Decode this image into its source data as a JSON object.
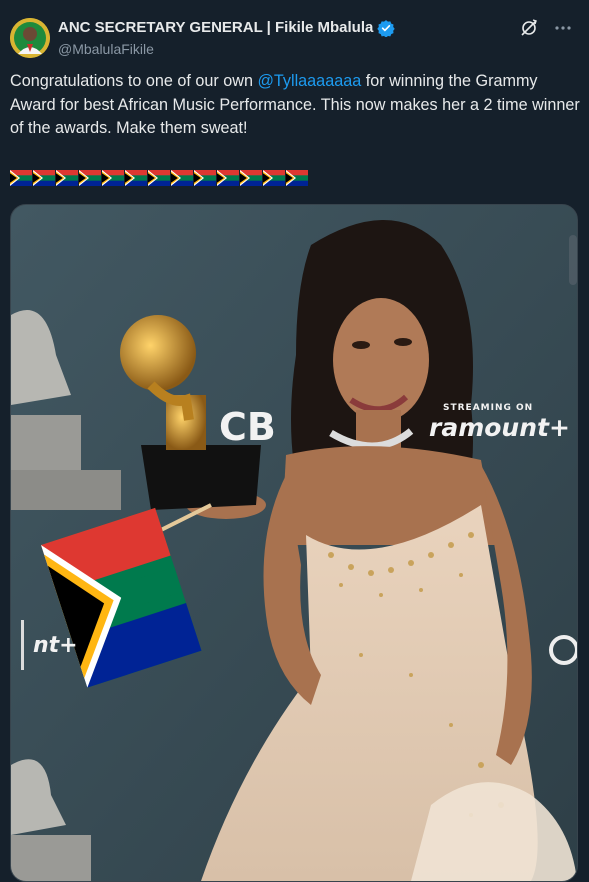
{
  "author": {
    "display_name": "ANC SECRETARY GENERAL | Fikile Mbalula",
    "handle": "@MbalulaFikile",
    "verified": true,
    "avatar_icon": "avatar-photo"
  },
  "header_actions": {
    "grok_icon": "grok-icon",
    "more_icon": "more-dots-icon"
  },
  "tweet": {
    "text_before_mention": "Congratulations to one of our own ",
    "mention": "@Tyllaaaaaaa",
    "text_after_mention": " for winning the Grammy Award for best African Music Performance. This now makes her a 2 time winner of the awards. Make them sweat!",
    "flag_count": 13,
    "flag_icon": "south-africa-flag-emoji"
  },
  "media": {
    "backdrop": {
      "streaming_label": "STREAMING ON",
      "brand": "ramount+",
      "network": "CB",
      "brand_partial": "nt+"
    }
  },
  "colors": {
    "background": "#15202b",
    "text": "#e7e9ea",
    "secondary_text": "#8b98a5",
    "link": "#1d9bf0",
    "verified": "#1d9bf0"
  }
}
